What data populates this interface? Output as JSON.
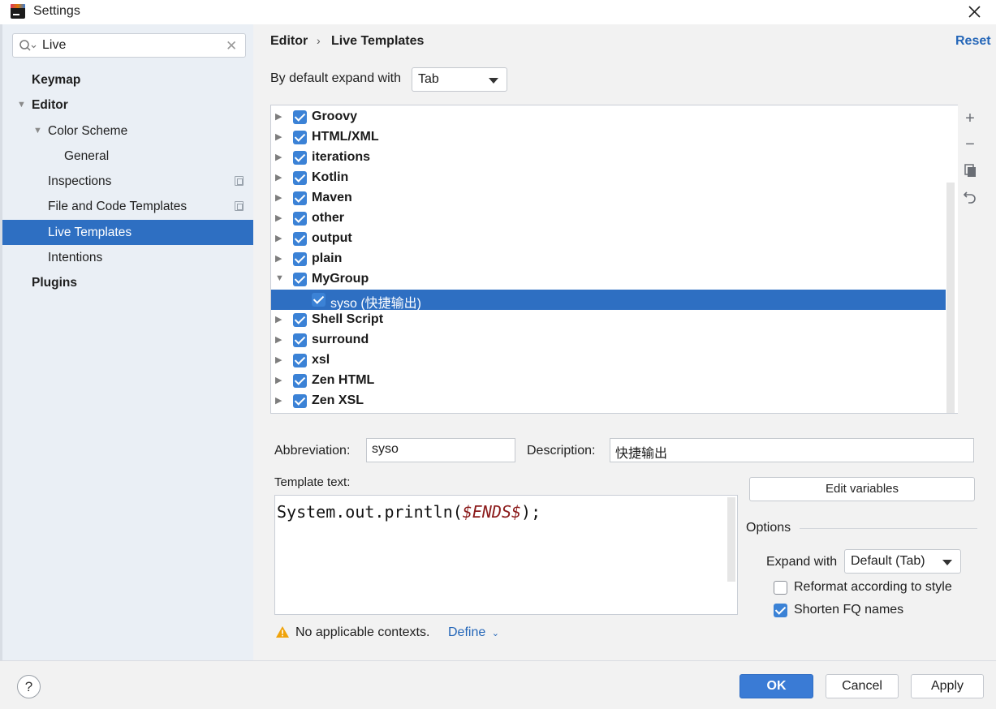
{
  "window": {
    "title": "Settings"
  },
  "sidebar": {
    "search": {
      "value": "Live"
    },
    "items": [
      {
        "label": "Keymap"
      },
      {
        "label": "Editor"
      },
      {
        "label": "Color Scheme"
      },
      {
        "label": "General"
      },
      {
        "label": "Inspections"
      },
      {
        "label": "File and Code Templates"
      },
      {
        "label": "Live Templates"
      },
      {
        "label": "Intentions"
      },
      {
        "label": "Plugins"
      }
    ]
  },
  "header": {
    "breadcrumb": [
      "Editor",
      "Live Templates"
    ],
    "reset_label": "Reset"
  },
  "expand_default": {
    "label": "By default expand with",
    "value": "Tab"
  },
  "tree": {
    "groups": [
      {
        "label": "Groovy",
        "checked": true
      },
      {
        "label": "HTML/XML",
        "checked": true
      },
      {
        "label": "iterations",
        "checked": true
      },
      {
        "label": "Kotlin",
        "checked": true
      },
      {
        "label": "Maven",
        "checked": true
      },
      {
        "label": "other",
        "checked": true
      },
      {
        "label": "output",
        "checked": true
      },
      {
        "label": "plain",
        "checked": true
      },
      {
        "label": "MyGroup",
        "checked": true
      },
      {
        "label": "syso (快捷输出)",
        "checked": true
      },
      {
        "label": "Shell Script",
        "checked": true
      },
      {
        "label": "surround",
        "checked": true
      },
      {
        "label": "xsl",
        "checked": true
      },
      {
        "label": "Zen HTML",
        "checked": true
      },
      {
        "label": "Zen XSL",
        "checked": true
      }
    ],
    "toolbar": [
      "add-icon",
      "remove-icon",
      "copy-icon",
      "undo-icon"
    ]
  },
  "detail": {
    "abbreviation_label": "Abbreviation:",
    "abbreviation_value": "syso",
    "description_label": "Description:",
    "description_value": "快捷输出",
    "template_text_label": "Template text:",
    "template_code_prefix": "System.out.println(",
    "template_code_var": "$ENDS$",
    "template_code_suffix": ");",
    "edit_variables_label": "Edit variables",
    "options_title": "Options",
    "expand_with_label": "Expand with",
    "expand_with_value": "Default (Tab)",
    "reformat_label": "Reformat according to style",
    "reformat_checked": false,
    "shorten_label": "Shorten FQ names",
    "shorten_checked": true,
    "warning_text": "No applicable contexts.",
    "define_label": "Define"
  },
  "footer": {
    "help_label": "?",
    "ok_label": "OK",
    "cancel_label": "Cancel",
    "apply_label": "Apply"
  }
}
